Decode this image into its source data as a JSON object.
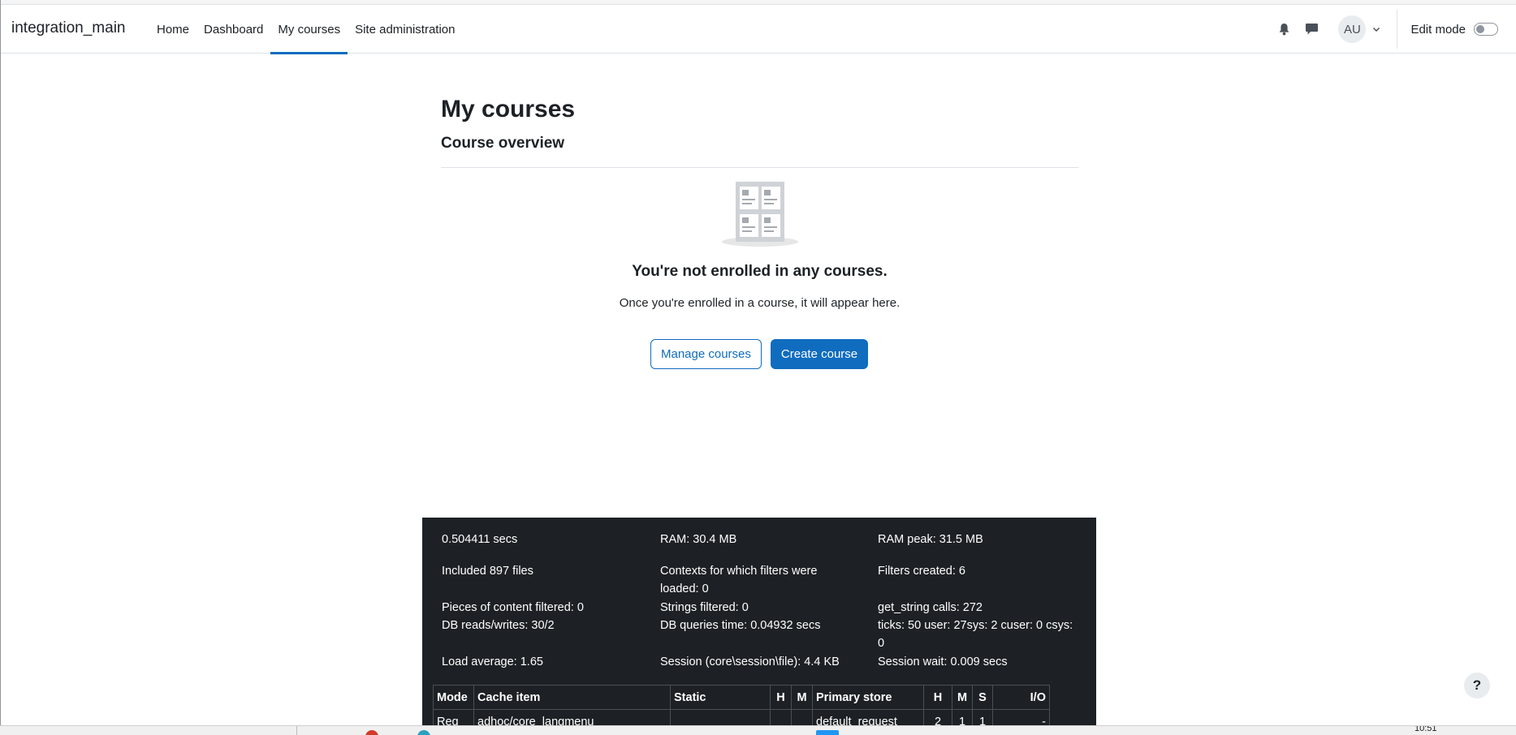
{
  "navbar": {
    "brand": "integration_main",
    "items": [
      {
        "label": "Home",
        "active": false
      },
      {
        "label": "Dashboard",
        "active": false
      },
      {
        "label": "My courses",
        "active": true
      },
      {
        "label": "Site administration",
        "active": false
      }
    ],
    "avatar_initials": "AU",
    "edit_mode_label": "Edit mode",
    "edit_mode_on": false,
    "icons": [
      "bell-icon",
      "chat-icon",
      "chevron-down-icon"
    ]
  },
  "main": {
    "page_title": "My courses",
    "section_title": "Course overview",
    "empty_title": "You're not enrolled in any courses.",
    "empty_text": "Once you're enrolled in a course, it will appear here.",
    "manage_button": "Manage courses",
    "create_button": "Create course"
  },
  "performance": {
    "time": "0.504411 secs",
    "ram": "RAM: 30.4 MB",
    "ram_peak": "RAM peak: 31.5 MB",
    "included_files": "Included 897 files",
    "contexts_filters": "Contexts for which filters were loaded: 0",
    "filters_created": "Filters created: 6",
    "pieces_filtered": "Pieces of content filtered: 0",
    "strings_filtered": "Strings filtered: 0",
    "get_string_calls": "get_string calls: 272",
    "db_reads_writes": "DB reads/writes: 30/2",
    "db_queries_time": "DB queries time: 0.04932 secs",
    "ticks": "ticks: 50 user: 27sys: 2 cuser: 0 csys: 0",
    "load_average": "Load average: 1.65",
    "session": "Session (core\\session\\file): 4.4 KB",
    "session_wait": "Session wait: 0.009 secs",
    "cache_table": {
      "headers": [
        "Mode",
        "Cache item",
        "Static",
        "H",
        "M",
        "Primary store",
        "H",
        "M",
        "S",
        "I/O"
      ],
      "rows": [
        [
          "Req",
          "adhoc/core_langmenu",
          "",
          "",
          "",
          "default_request",
          "2",
          "1",
          "1",
          "-"
        ]
      ]
    }
  },
  "help_label": "?",
  "taskbar": {
    "clock": "10:51"
  },
  "colors": {
    "brand_blue": "#0f6cbf",
    "footer_bg": "#1d2125"
  }
}
